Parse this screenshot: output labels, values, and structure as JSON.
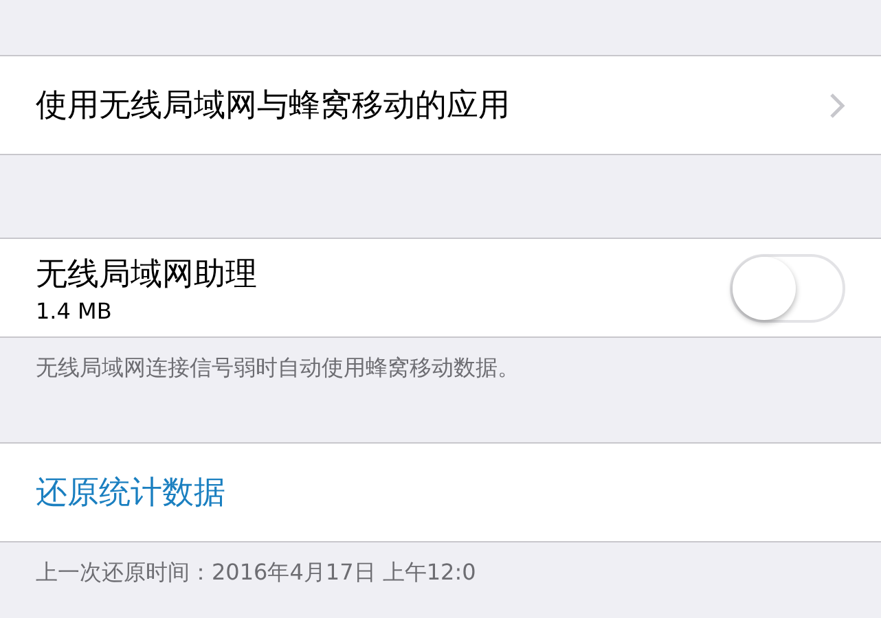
{
  "sections": [
    {
      "kind": "link",
      "label": "使用无线局域网与蜂窝移动的应用"
    },
    {
      "kind": "toggle",
      "label": "无线局域网助理",
      "detail": "1.4 MB",
      "on": false,
      "footer": "无线局域网连接信号弱时自动使用蜂窝移动数据。"
    },
    {
      "kind": "action",
      "label": "还原统计数据",
      "footer": "上一次还原时间：2016年4月17日 上午12:0"
    }
  ]
}
